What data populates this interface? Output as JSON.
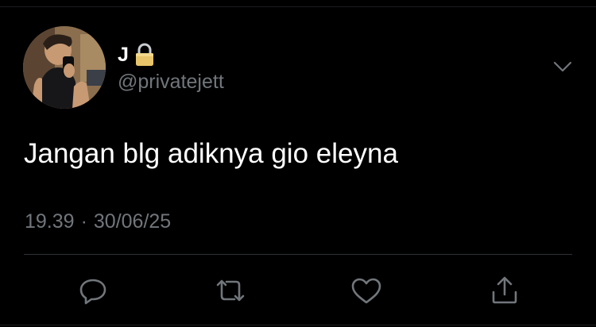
{
  "tweet": {
    "display_name": "J",
    "handle": "@privatejett",
    "text": "Jangan blg adiknya gio eleyna",
    "time": "19.39",
    "separator": "·",
    "date": "30/06/25"
  },
  "icons": {
    "avatar": "profile-photo",
    "lock": "lock-icon",
    "menu": "chevron-down-icon",
    "reply": "reply-icon",
    "retweet": "retweet-icon",
    "like": "heart-icon",
    "share": "share-icon"
  },
  "colors": {
    "background": "#000000",
    "primary_text": "#ffffff",
    "secondary_text": "#71767b",
    "lock": "#e8c56a",
    "icon": "#71767b",
    "divider": "#2f3336"
  }
}
